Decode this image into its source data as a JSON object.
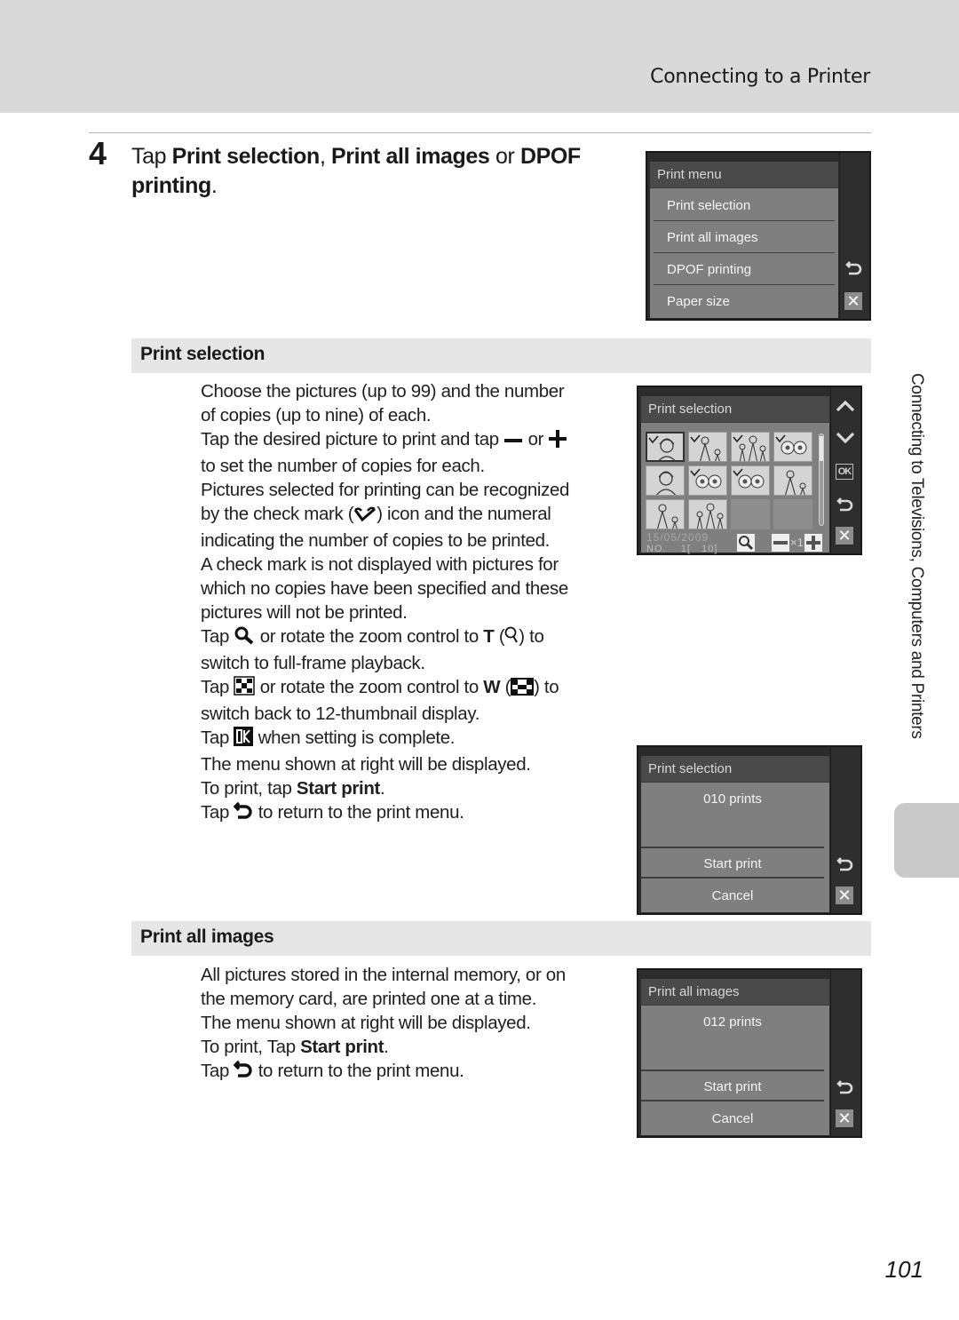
{
  "header": {
    "section_title": "Connecting to a Printer"
  },
  "step": {
    "number": "4",
    "text_parts": {
      "prefix": "Tap ",
      "opt1": "Print selection",
      "sep1": ", ",
      "opt2": "Print all images",
      "sep2": " or ",
      "opt3": "DPOF printing",
      "suffix": "."
    }
  },
  "print_menu_screen": {
    "title": "Print menu",
    "items": [
      "Print selection",
      "Print all images",
      "DPOF printing",
      "Paper size"
    ],
    "side_icons": [
      "return-icon",
      "close-icon"
    ]
  },
  "print_selection": {
    "heading": "Print selection",
    "paragraphs": [
      [
        "Choose the pictures (up to 99) and the number",
        "of copies (up to nine) of each."
      ],
      [
        "Tap the desired picture to print and tap ",
        " or ",
        "to set the number of copies for each."
      ],
      [
        "Pictures selected for printing can be recognized",
        "by the check mark (",
        ") icon and the numeral",
        "indicating the number of copies to be printed."
      ],
      [
        "A check mark is not displayed with pictures for",
        "which no copies have been specified and these",
        "pictures will not be printed."
      ],
      [
        "Tap ",
        " or rotate the zoom control to ",
        "T",
        " (",
        ") to",
        "switch to full-frame playback."
      ],
      [
        "Tap ",
        " or rotate the zoom control to ",
        "W",
        " (",
        ") to",
        "switch back to 12-thumbnail display."
      ],
      [
        "Tap ",
        " when setting is complete."
      ],
      [
        "The menu shown at right will be displayed."
      ],
      [
        "To print, tap ",
        "Start print",
        "."
      ],
      [
        "Tap ",
        " to return to the print menu."
      ]
    ],
    "thumbnail_screen": {
      "title": "Print selection",
      "thumbnails": [
        {
          "subject": "woman-portrait",
          "checked": true,
          "selected": true
        },
        {
          "subject": "woman-child",
          "checked": true
        },
        {
          "subject": "family",
          "checked": true
        },
        {
          "subject": "flowers",
          "checked": true
        },
        {
          "subject": "woman-portrait",
          "checked": false
        },
        {
          "subject": "flowers",
          "checked": true
        },
        {
          "subject": "flowers",
          "checked": true
        },
        {
          "subject": "woman-child",
          "checked": false
        },
        {
          "subject": "woman-child",
          "checked": false
        },
        {
          "subject": "family",
          "checked": false
        },
        {
          "subject": "empty"
        },
        {
          "subject": "empty"
        }
      ],
      "date": "15/05/2009",
      "number_label": "NO.",
      "number_value": "1[   10]",
      "copies": "×1",
      "side_icons": [
        "up-icon",
        "down-icon",
        "ok-icon",
        "return-icon",
        "close-icon"
      ]
    },
    "confirm_screen": {
      "title": "Print selection",
      "count": "010 prints",
      "start": "Start print",
      "cancel": "Cancel"
    }
  },
  "print_all_images": {
    "heading": "Print all images",
    "paragraphs": [
      [
        "All pictures stored in the internal memory, or on",
        "the memory card, are printed one at a time."
      ],
      [
        "The menu shown at right will be displayed."
      ],
      [
        "To print, Tap ",
        "Start print",
        "."
      ],
      [
        "Tap ",
        " to return to the print menu."
      ]
    ],
    "confirm_screen": {
      "title": "Print all images",
      "count": "012 prints",
      "start": "Start print",
      "cancel": "Cancel"
    }
  },
  "side_tab": {
    "label": "Connecting to Televisions, Computers and Printers"
  },
  "page_number": "101"
}
